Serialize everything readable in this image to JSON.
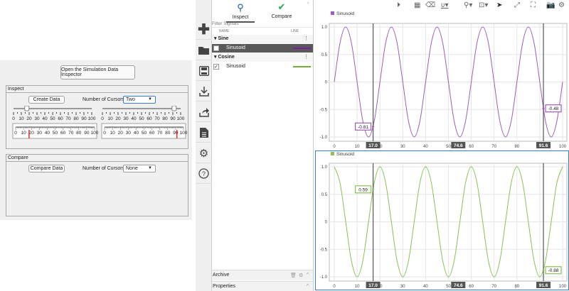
{
  "app": {
    "open_sdi_button": "Open the Simulation Data Inspector",
    "inspect": {
      "title": "Inspect",
      "create_button": "Create Data",
      "cursors_label": "Number of Cursors",
      "cursors_value": "Two",
      "slider1_value": 17,
      "slider2_value": 91.6,
      "scale_ticks": [
        "0",
        "10",
        "20",
        "30",
        "40",
        "50",
        "60",
        "70",
        "80",
        "90",
        "100"
      ]
    },
    "compare": {
      "title": "Compare",
      "compare_button": "Compare Data",
      "cursors_label": "Number of Cursors",
      "cursors_value": "None"
    }
  },
  "sidebar_icons": [
    "plus-icon",
    "folder-icon",
    "save-icon",
    "import-icon",
    "share-icon",
    "report-icon",
    "gear-icon",
    "help-icon"
  ],
  "signals": {
    "tabs": [
      {
        "label": "Inspect",
        "icon": "search-icon"
      },
      {
        "label": "Compare",
        "icon": "check-circle-icon"
      }
    ],
    "filter_placeholder": "Filter Signals",
    "col_name": "NAME",
    "col_line": "LINE",
    "groups": [
      {
        "name": "Sine",
        "signal": "Sinusoid",
        "checked": false,
        "selected": true,
        "color": "#7e1e9c"
      },
      {
        "name": "Cosine",
        "signal": "Sinusoid",
        "checked": true,
        "selected": false,
        "color": "#77ac30"
      }
    ],
    "archive": "Archive",
    "properties": "Properties"
  },
  "toolbar_icons": [
    "play-icon",
    "layout-icon",
    "eraser-icon",
    "signal-style-icon",
    "zoom-icon",
    "fit-icon",
    "cursor-icon",
    "expand-icon",
    "fullscreen-icon",
    "camera-icon",
    "settings-icon"
  ],
  "chart_data": [
    {
      "type": "line",
      "legend": "Sinusoid",
      "color": "#a05cb8",
      "xlim": [
        0,
        100
      ],
      "ylim": [
        -1,
        1
      ],
      "xticks": [
        "0",
        "10",
        "20",
        "30",
        "40",
        "50",
        "60",
        "70",
        "80",
        "90",
        "100"
      ],
      "yticks": [
        "1.0",
        "0.5",
        "0",
        "-0.5",
        "-1.0"
      ],
      "grid": true,
      "x_step": 2.5,
      "values": [
        0,
        0.71,
        1,
        0.71,
        0,
        -0.71,
        -1,
        -0.71,
        0,
        0.71,
        1,
        0.71,
        0,
        -0.71,
        -1,
        -0.71,
        0,
        0.71,
        1,
        0.71,
        0,
        -0.71,
        -1,
        -0.71,
        0,
        0.71,
        1,
        0.71,
        0,
        -0.71,
        -1,
        -0.71,
        0,
        0.71,
        1,
        0.71,
        0,
        -0.71,
        -1,
        -0.71,
        0
      ],
      "cursors": [
        {
          "x": 17.0,
          "label": "17.0",
          "readout": "-0.81",
          "y": -0.81
        },
        {
          "x": 91.6,
          "label": "91.6",
          "readout": "-0.48",
          "y": -0.48
        }
      ],
      "delta": "74.6"
    },
    {
      "type": "line",
      "legend": "Sinusoid",
      "color": "#8cc152",
      "xlim": [
        0,
        100
      ],
      "ylim": [
        -1,
        1
      ],
      "xticks": [
        "0",
        "10",
        "20",
        "30",
        "40",
        "50",
        "60",
        "70",
        "80",
        "90",
        "100"
      ],
      "yticks": [
        "1.0",
        "0.5",
        "0",
        "-0.5",
        "-1.0"
      ],
      "grid": true,
      "x_step": 2.5,
      "values": [
        1,
        0.71,
        0,
        -0.71,
        -1,
        -0.71,
        0,
        0.71,
        1,
        0.71,
        0,
        -0.71,
        -1,
        -0.71,
        0,
        0.71,
        1,
        0.71,
        0,
        -0.71,
        -1,
        -0.71,
        0,
        0.71,
        1,
        0.71,
        0,
        -0.71,
        -1,
        -0.71,
        0,
        0.71,
        1,
        0.71,
        0,
        -0.71,
        -1,
        -0.71,
        0,
        0.71,
        1
      ],
      "cursors": [
        {
          "x": 17.0,
          "label": "17.0",
          "readout": "0.59",
          "y": 0.59
        },
        {
          "x": 91.6,
          "label": "91.6",
          "readout": "-0.88",
          "y": -0.88
        }
      ],
      "delta": "74.6"
    }
  ]
}
